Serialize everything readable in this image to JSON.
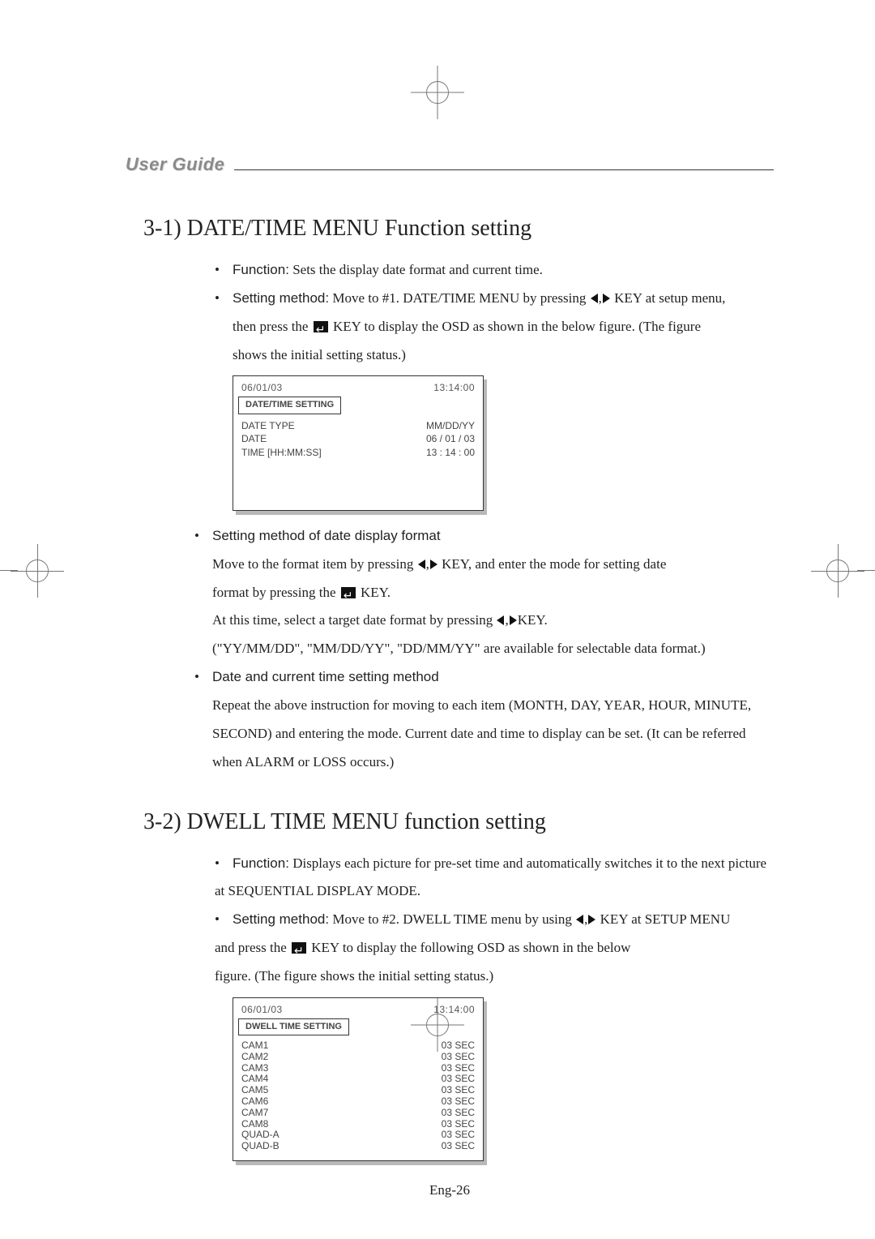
{
  "header": {
    "brand": "User Guide"
  },
  "section_1": {
    "title": "3-1)  DATE/TIME MENU Function setting",
    "items": [
      {
        "label": "Function:",
        "text": " Sets the display date format and current time."
      },
      {
        "label": "Setting method:",
        "text_pre": " Move to #1. DATE/TIME MENU by pressing ",
        "key_text": "KEY at setup menu,",
        "line2_a": "then press the ",
        "line2_b": " KEY to display the OSD as shown in the below figure. (The figure",
        "line3": "shows the initial setting status.)"
      }
    ],
    "osd": {
      "date": "06/01/03",
      "time": "13:14:00",
      "title": "DATE/TIME  SETTING",
      "rows": [
        {
          "k": "DATE TYPE",
          "v": "MM/DD/YY"
        },
        {
          "k": "DATE",
          "v": "06 / 01 / 03"
        },
        {
          "k": "TIME [HH:MM:SS]",
          "v": "13 : 14 : 00"
        }
      ]
    },
    "items2": [
      {
        "label": "Setting method of date display format",
        "l1_a": "Move to the format item by pressing ",
        "l1_b": " KEY, and enter the mode for setting date",
        "l2_a": "format by pressing the ",
        "l2_b": " KEY.",
        "l3_a": "At this time, select a target date format by pressing ",
        "l3_b": "KEY.",
        "l4": "(\"YY/MM/DD\", \"MM/DD/YY\", \"DD/MM/YY\" are available for selectable data format.)"
      },
      {
        "label": "Date and current time setting method",
        "l1": "Repeat the above instruction for moving to each item (MONTH, DAY, YEAR, HOUR, MINUTE,",
        "l2": "SECOND) and entering the mode. Current date and time to display can be set. (It can be referred",
        "l3": "when ALARM or LOSS occurs.)"
      }
    ]
  },
  "section_2": {
    "title": "3-2)  DWELL TIME MENU function setting",
    "items": [
      {
        "label": "Function:",
        "l1": "  Displays each picture for pre-set time and automatically switches it to the next picture",
        "l2": "at SEQUENTIAL DISPLAY MODE."
      },
      {
        "label": "Setting method:",
        "l1_a": "  Move to #2. DWELL TIME menu by using ",
        "l1_b": " KEY at SETUP MENU",
        "l2_a": "and press the ",
        "l2_b": " KEY to display the following OSD as shown in the below",
        "l3": "figure. (The figure shows the initial setting status.)"
      }
    ],
    "osd": {
      "date": "06/01/03",
      "time": "13:14:00",
      "title": "DWELL TIME SETTING",
      "rows": [
        {
          "k": "CAM1",
          "v": "03 SEC"
        },
        {
          "k": "CAM2",
          "v": "03 SEC"
        },
        {
          "k": "CAM3",
          "v": "03 SEC"
        },
        {
          "k": "CAM4",
          "v": "03 SEC"
        },
        {
          "k": "CAM5",
          "v": "03 SEC"
        },
        {
          "k": "CAM6",
          "v": "03 SEC"
        },
        {
          "k": "CAM7",
          "v": "03 SEC"
        },
        {
          "k": "CAM8",
          "v": "03 SEC"
        },
        {
          "k": "QUAD-A",
          "v": "03 SEC"
        },
        {
          "k": "QUAD-B",
          "v": "03 SEC"
        }
      ]
    }
  },
  "footer": {
    "page": "Eng-26"
  }
}
